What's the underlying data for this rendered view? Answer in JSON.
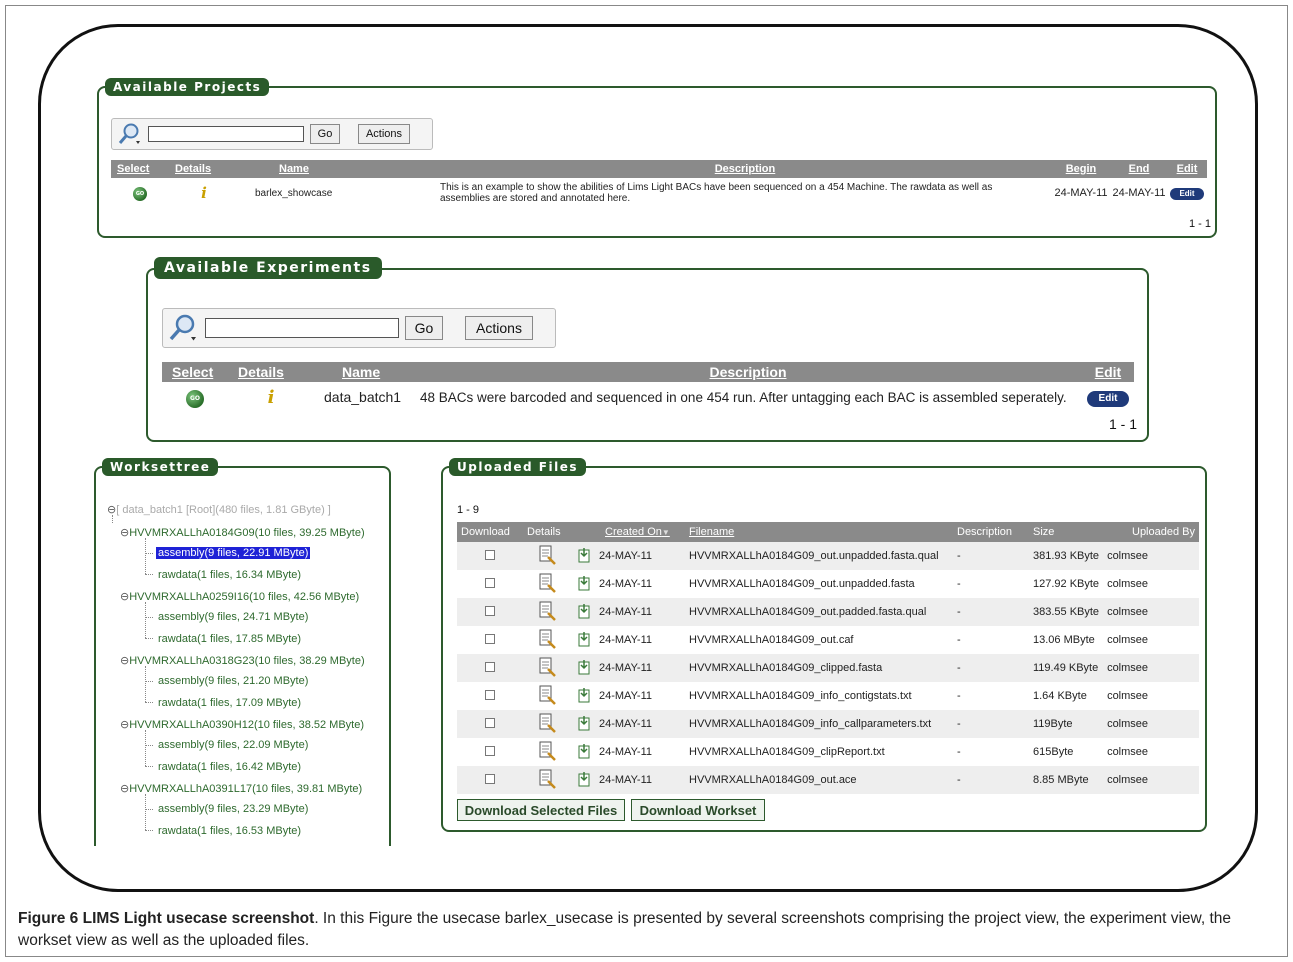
{
  "projects": {
    "title": "Available Projects",
    "search_placeholder": "",
    "go_label": "Go",
    "actions_label": "Actions",
    "columns": [
      "Select",
      "Details",
      "Name",
      "Description",
      "Begin",
      "End",
      "Edit"
    ],
    "rows": [
      {
        "select_icon": "GO",
        "details_icon": "i",
        "name": "barlex_showcase",
        "description_line1": "This is an example to show the abilities of Lims Light BACs have been sequenced on a 454 Machine. The rawdata as well as",
        "description_line2": "assemblies are stored and annotated here.",
        "begin": "24-MAY-11",
        "end": "24-MAY-11",
        "edit": "Edit"
      }
    ],
    "pagination": "1 - 1"
  },
  "experiments": {
    "title": "Available Experiments",
    "go_label": "Go",
    "actions_label": "Actions",
    "columns": [
      "Select",
      "Details",
      "Name",
      "Description",
      "Edit"
    ],
    "rows": [
      {
        "select_icon": "GO",
        "details_icon": "i",
        "name": "data_batch1",
        "description": "48 BACs were barcoded and sequenced in one 454 run. After untagging each BAC is assembled seperately.",
        "edit": "Edit"
      }
    ],
    "pagination": "1 - 1"
  },
  "worksettree": {
    "title": "Worksettree",
    "root": "[ data_batch1 [Root](480 files, 1.81 GByte) ]",
    "groups": [
      {
        "label": "HVVMRXALLhA0184G09(10 files, 39.25 MByte)",
        "children": [
          "assembly(9 files, 22.91 MByte)",
          "rawdata(1 files, 16.34 MByte)"
        ]
      },
      {
        "label": "HVVMRXALLhA0259I16(10 files, 42.56 MByte)",
        "children": [
          "assembly(9 files, 24.71 MByte)",
          "rawdata(1 files, 17.85 MByte)"
        ]
      },
      {
        "label": "HVVMRXALLhA0318G23(10 files, 38.29 MByte)",
        "children": [
          "assembly(9 files, 21.20 MByte)",
          "rawdata(1 files, 17.09 MByte)"
        ]
      },
      {
        "label": "HVVMRXALLhA0390H12(10 files, 38.52 MByte)",
        "children": [
          "assembly(9 files, 22.09 MByte)",
          "rawdata(1 files, 16.42 MByte)"
        ]
      },
      {
        "label": "HVVMRXALLhA0391L17(10 files, 39.81 MByte)",
        "children": [
          "assembly(9 files, 23.29 MByte)",
          "rawdata(1 files, 16.53 MByte)"
        ]
      }
    ]
  },
  "uploaded": {
    "title": "Uploaded Files",
    "range": "1 - 9",
    "columns": [
      "Download",
      "Details",
      "",
      "Created On",
      "Filename",
      "Description",
      "Size",
      "Uploaded By"
    ],
    "sort_indicator": "▼",
    "rows": [
      {
        "created": "24-MAY-11",
        "filename": "HVVMRXALLhA0184G09_out.unpadded.fasta.qual",
        "description": "-",
        "size": "381.93 KByte",
        "by": "colmsee"
      },
      {
        "created": "24-MAY-11",
        "filename": "HVVMRXALLhA0184G09_out.unpadded.fasta",
        "description": "-",
        "size": "127.92 KByte",
        "by": "colmsee"
      },
      {
        "created": "24-MAY-11",
        "filename": "HVVMRXALLhA0184G09_out.padded.fasta.qual",
        "description": "-",
        "size": "383.55 KByte",
        "by": "colmsee"
      },
      {
        "created": "24-MAY-11",
        "filename": "HVVMRXALLhA0184G09_out.caf",
        "description": "-",
        "size": "13.06 MByte",
        "by": "colmsee"
      },
      {
        "created": "24-MAY-11",
        "filename": "HVVMRXALLhA0184G09_clipped.fasta",
        "description": "-",
        "size": "119.49 KByte",
        "by": "colmsee"
      },
      {
        "created": "24-MAY-11",
        "filename": "HVVMRXALLhA0184G09_info_contigstats.txt",
        "description": "-",
        "size": "1.64 KByte",
        "by": "colmsee"
      },
      {
        "created": "24-MAY-11",
        "filename": "HVVMRXALLhA0184G09_info_callparameters.txt",
        "description": "-",
        "size": "119Byte",
        "by": "colmsee"
      },
      {
        "created": "24-MAY-11",
        "filename": "HVVMRXALLhA0184G09_clipReport.txt",
        "description": "-",
        "size": "615Byte",
        "by": "colmsee"
      },
      {
        "created": "24-MAY-11",
        "filename": "HVVMRXALLhA0184G09_out.ace",
        "description": "-",
        "size": "8.85 MByte",
        "by": "colmsee"
      }
    ],
    "download_selected_label": "Download Selected Files",
    "download_workset_label": "Download Workset"
  },
  "caption": {
    "bold": "Figure 6 LIMS Light usecase screenshot",
    "text": ". In this Figure the usecase barlex_usecase is presented by several screenshots comprising the project view, the experiment view, the workset view as well as the uploaded files."
  }
}
